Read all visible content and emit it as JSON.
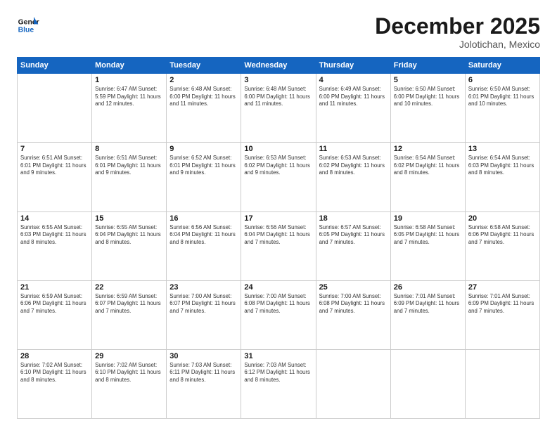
{
  "logo": {
    "line1": "General",
    "line2": "Blue"
  },
  "header": {
    "month": "December 2025",
    "location": "Jolotichan, Mexico"
  },
  "days_of_week": [
    "Sunday",
    "Monday",
    "Tuesday",
    "Wednesday",
    "Thursday",
    "Friday",
    "Saturday"
  ],
  "weeks": [
    [
      {
        "day": "",
        "info": ""
      },
      {
        "day": "1",
        "info": "Sunrise: 6:47 AM\nSunset: 5:59 PM\nDaylight: 11 hours\nand 12 minutes."
      },
      {
        "day": "2",
        "info": "Sunrise: 6:48 AM\nSunset: 6:00 PM\nDaylight: 11 hours\nand 11 minutes."
      },
      {
        "day": "3",
        "info": "Sunrise: 6:48 AM\nSunset: 6:00 PM\nDaylight: 11 hours\nand 11 minutes."
      },
      {
        "day": "4",
        "info": "Sunrise: 6:49 AM\nSunset: 6:00 PM\nDaylight: 11 hours\nand 11 minutes."
      },
      {
        "day": "5",
        "info": "Sunrise: 6:50 AM\nSunset: 6:00 PM\nDaylight: 11 hours\nand 10 minutes."
      },
      {
        "day": "6",
        "info": "Sunrise: 6:50 AM\nSunset: 6:01 PM\nDaylight: 11 hours\nand 10 minutes."
      }
    ],
    [
      {
        "day": "7",
        "info": "Sunrise: 6:51 AM\nSunset: 6:01 PM\nDaylight: 11 hours\nand 9 minutes."
      },
      {
        "day": "8",
        "info": "Sunrise: 6:51 AM\nSunset: 6:01 PM\nDaylight: 11 hours\nand 9 minutes."
      },
      {
        "day": "9",
        "info": "Sunrise: 6:52 AM\nSunset: 6:01 PM\nDaylight: 11 hours\nand 9 minutes."
      },
      {
        "day": "10",
        "info": "Sunrise: 6:53 AM\nSunset: 6:02 PM\nDaylight: 11 hours\nand 9 minutes."
      },
      {
        "day": "11",
        "info": "Sunrise: 6:53 AM\nSunset: 6:02 PM\nDaylight: 11 hours\nand 8 minutes."
      },
      {
        "day": "12",
        "info": "Sunrise: 6:54 AM\nSunset: 6:02 PM\nDaylight: 11 hours\nand 8 minutes."
      },
      {
        "day": "13",
        "info": "Sunrise: 6:54 AM\nSunset: 6:03 PM\nDaylight: 11 hours\nand 8 minutes."
      }
    ],
    [
      {
        "day": "14",
        "info": "Sunrise: 6:55 AM\nSunset: 6:03 PM\nDaylight: 11 hours\nand 8 minutes."
      },
      {
        "day": "15",
        "info": "Sunrise: 6:55 AM\nSunset: 6:04 PM\nDaylight: 11 hours\nand 8 minutes."
      },
      {
        "day": "16",
        "info": "Sunrise: 6:56 AM\nSunset: 6:04 PM\nDaylight: 11 hours\nand 8 minutes."
      },
      {
        "day": "17",
        "info": "Sunrise: 6:56 AM\nSunset: 6:04 PM\nDaylight: 11 hours\nand 7 minutes."
      },
      {
        "day": "18",
        "info": "Sunrise: 6:57 AM\nSunset: 6:05 PM\nDaylight: 11 hours\nand 7 minutes."
      },
      {
        "day": "19",
        "info": "Sunrise: 6:58 AM\nSunset: 6:05 PM\nDaylight: 11 hours\nand 7 minutes."
      },
      {
        "day": "20",
        "info": "Sunrise: 6:58 AM\nSunset: 6:06 PM\nDaylight: 11 hours\nand 7 minutes."
      }
    ],
    [
      {
        "day": "21",
        "info": "Sunrise: 6:59 AM\nSunset: 6:06 PM\nDaylight: 11 hours\nand 7 minutes."
      },
      {
        "day": "22",
        "info": "Sunrise: 6:59 AM\nSunset: 6:07 PM\nDaylight: 11 hours\nand 7 minutes."
      },
      {
        "day": "23",
        "info": "Sunrise: 7:00 AM\nSunset: 6:07 PM\nDaylight: 11 hours\nand 7 minutes."
      },
      {
        "day": "24",
        "info": "Sunrise: 7:00 AM\nSunset: 6:08 PM\nDaylight: 11 hours\nand 7 minutes."
      },
      {
        "day": "25",
        "info": "Sunrise: 7:00 AM\nSunset: 6:08 PM\nDaylight: 11 hours\nand 7 minutes."
      },
      {
        "day": "26",
        "info": "Sunrise: 7:01 AM\nSunset: 6:09 PM\nDaylight: 11 hours\nand 7 minutes."
      },
      {
        "day": "27",
        "info": "Sunrise: 7:01 AM\nSunset: 6:09 PM\nDaylight: 11 hours\nand 7 minutes."
      }
    ],
    [
      {
        "day": "28",
        "info": "Sunrise: 7:02 AM\nSunset: 6:10 PM\nDaylight: 11 hours\nand 8 minutes."
      },
      {
        "day": "29",
        "info": "Sunrise: 7:02 AM\nSunset: 6:10 PM\nDaylight: 11 hours\nand 8 minutes."
      },
      {
        "day": "30",
        "info": "Sunrise: 7:03 AM\nSunset: 6:11 PM\nDaylight: 11 hours\nand 8 minutes."
      },
      {
        "day": "31",
        "info": "Sunrise: 7:03 AM\nSunset: 6:12 PM\nDaylight: 11 hours\nand 8 minutes."
      },
      {
        "day": "",
        "info": ""
      },
      {
        "day": "",
        "info": ""
      },
      {
        "day": "",
        "info": ""
      }
    ]
  ]
}
